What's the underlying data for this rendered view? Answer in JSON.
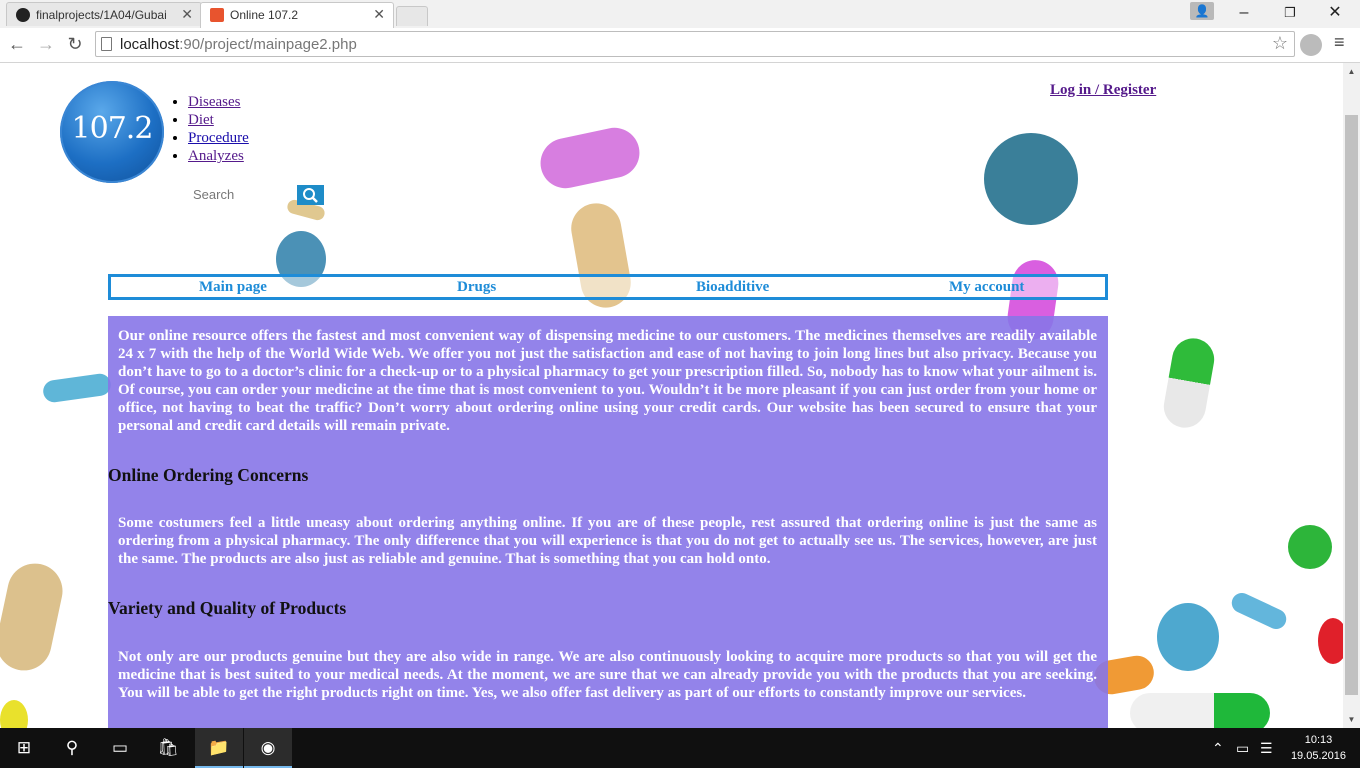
{
  "browser": {
    "tabs": [
      {
        "title": "finalprojects/1A04/Gubai",
        "active": false
      },
      {
        "title": "Online 107.2",
        "active": true
      }
    ],
    "url_host": "localhost",
    "url_path": ":90/project/mainpage2.php"
  },
  "page": {
    "logo_text": "107.2",
    "top_links": [
      "Diseases",
      "Diet",
      "Procedure",
      "Analyzes"
    ],
    "login_label": "Log in / Register",
    "search_placeholder": "Search",
    "menu": [
      "Main page",
      "Drugs",
      "Bioadditive",
      "My account"
    ],
    "intro": "Our online resource offers the fastest and most convenient way of dispensing medicine to our customers. The medicines themselves are readily available 24 x 7 with the help of the World Wide Web. We offer you not just the satisfaction and ease of not having to join long lines but also privacy. Because you don’t have to go to a doctor’s clinic for a check-up or to a physical pharmacy to get your prescription filled. So, nobody has to know what your ailment is. Of course, you can order your medicine at the time that is most convenient to you. Wouldn’t it be more pleasant if you can just order from your home or office, not having to beat the traffic? Don’t worry about ordering online using your credit cards. Our website has been secured to ensure that your personal and credit card details will remain private.",
    "heading1": "Online Ordering Concerns",
    "para1": "Some costumers feel a little uneasy about ordering anything online. If you are of these people, rest assured that ordering online is just the same as ordering from a physical pharmacy. The only difference that you will experience is that you do not get to actually see us. The services, however, are just the same. The products are also just as reliable and genuine. That is something that you can hold onto.",
    "heading2": "Variety and Quality of Products",
    "para2": "Not only are our products genuine but they are also wide in range. We are also continuously looking to acquire more products so that you will get the medicine that is best suited to your medical needs. At the moment, we are sure that we can already provide you with the products that you are seeking. You will be able to get the right products right on time. Yes, we also offer fast delivery as part of our efforts to constantly improve our services."
  },
  "taskbar": {
    "time": "10:13",
    "date": "19.05.2016"
  },
  "colors": {
    "menu_accent": "#1e8cd8",
    "content_bg": "#8776e8",
    "logo_blue": "#1d6fc4"
  }
}
